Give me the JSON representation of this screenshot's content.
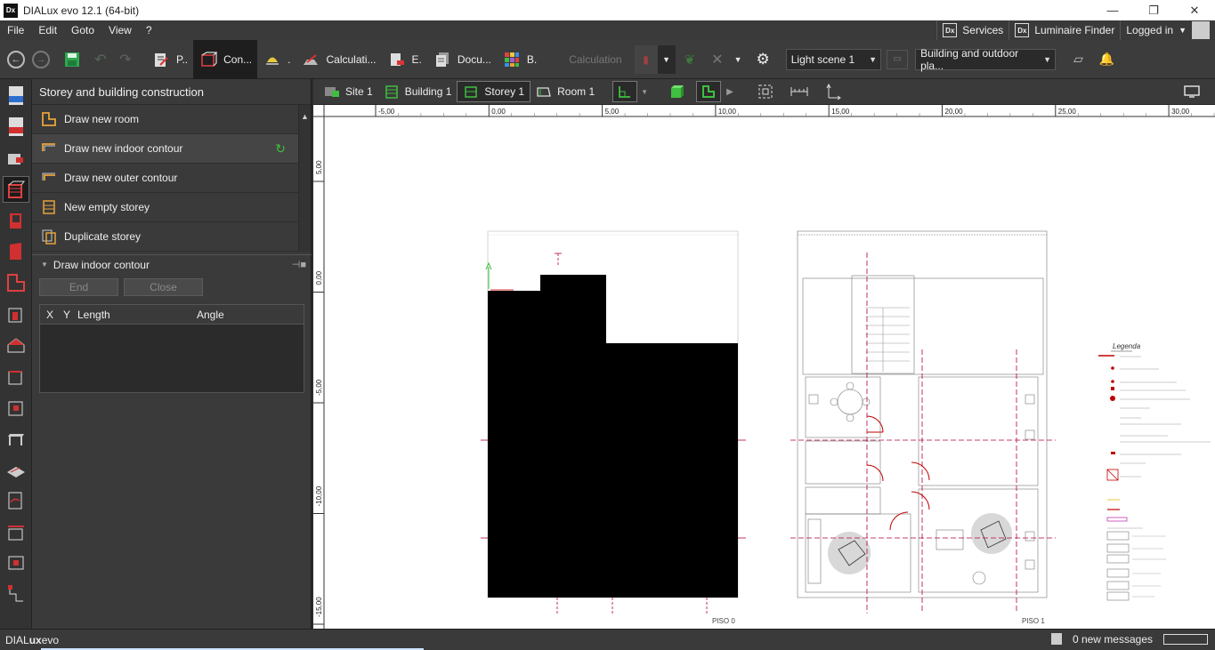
{
  "window": {
    "title": "DIALux evo 12.1  (64-bit)",
    "logo": "Dx"
  },
  "menu": {
    "items": [
      "File",
      "Edit",
      "Goto",
      "View",
      "?"
    ],
    "services": "Services",
    "luminaire_finder": "Luminaire Finder",
    "logged_in": "Logged in",
    "dx": "Dx"
  },
  "toolbar": {
    "modes": [
      {
        "label": "P..",
        "icon": "project-icon"
      },
      {
        "label": "Con...",
        "icon": "construction-icon",
        "active": true
      },
      {
        "label": ".",
        "icon": "light-icon"
      },
      {
        "label": "Calculati...",
        "icon": "calculation-icon"
      },
      {
        "label": "E.",
        "icon": "export-icon"
      },
      {
        "label": "Docu...",
        "icon": "documentation-icon"
      },
      {
        "label": "B.",
        "icon": "bim-icon"
      }
    ],
    "calculation_label": "Calculation",
    "light_scene": "Light scene 1",
    "view_select": "Building and outdoor pla..."
  },
  "panel": {
    "title": "Storey and building construction",
    "items": [
      {
        "label": "Draw new room"
      },
      {
        "label": "Draw new indoor contour"
      },
      {
        "label": "Draw new outer contour"
      },
      {
        "label": "New empty storey"
      },
      {
        "label": "Duplicate storey"
      }
    ],
    "sub_title": "Draw indoor contour",
    "end_button": "End",
    "close_button": "Close",
    "table_headers": [
      "X",
      "Y",
      "Length",
      "Angle"
    ]
  },
  "viewbar": {
    "crumbs": [
      "Site 1",
      "Building 1",
      "Storey 1",
      "Room 1"
    ]
  },
  "canvas": {
    "x_ticks": [
      "-5,00",
      "0,00",
      "5,00",
      "10,00",
      "15,00",
      "20,00",
      "25,00",
      "30,00"
    ],
    "y_ticks": [
      "5,00",
      "0,00",
      "-5,00",
      "-10,00",
      "-15,00"
    ],
    "plan_left_label": "PISO 0",
    "plan_right_label": "PISO 1",
    "legend_title": "Legenda"
  },
  "status": {
    "brand_a": "DIAL",
    "brand_b": "ux",
    "brand_c": "evo",
    "messages": "0 new messages"
  },
  "colors": {
    "accent_orange": "#e8a33a",
    "refresh_green": "#3fbf3f",
    "plan_red": "#b3003c"
  }
}
